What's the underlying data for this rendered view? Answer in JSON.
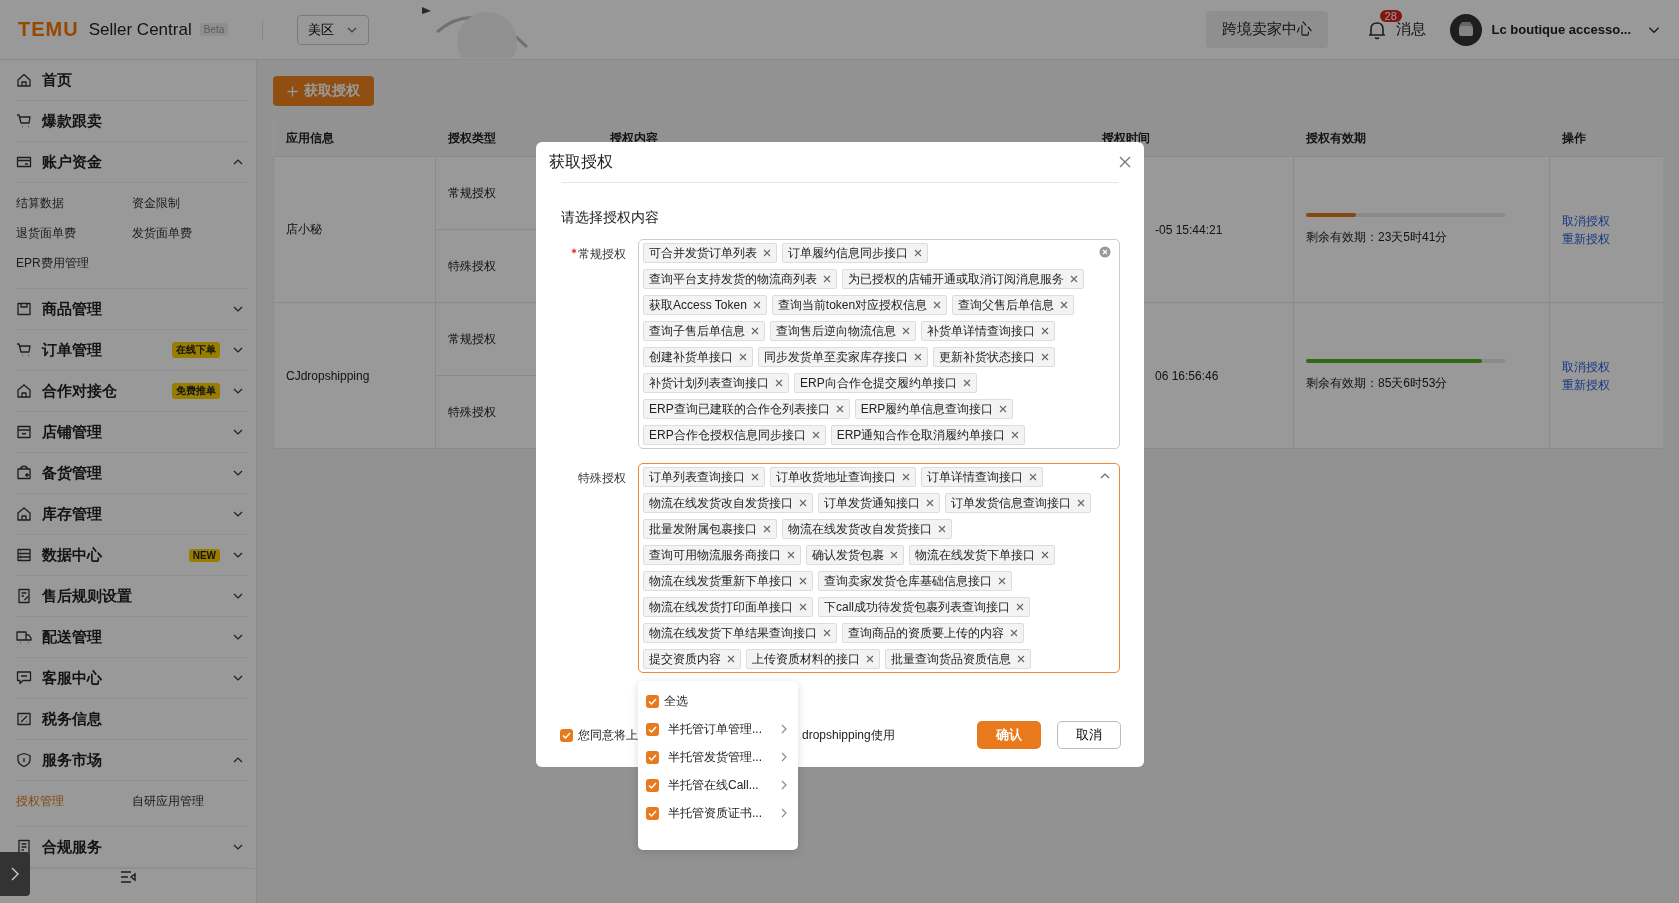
{
  "topbar": {
    "logo": "TEMU",
    "product": "Seller Central",
    "badge": "Beta",
    "region": "美区",
    "center_button": "跨境卖家中心",
    "notifications": {
      "label": "消息",
      "count": "28"
    },
    "account": "Lc boutique accesso..."
  },
  "sidebar": {
    "items": [
      {
        "label": "首页",
        "expandable": false
      },
      {
        "label": "爆款跟卖",
        "expandable": false
      },
      {
        "label": "账户资金",
        "expandable": true,
        "expanded": true,
        "children": [
          {
            "label": "结算数据",
            "selected": false
          },
          {
            "label": "资金限制",
            "selected": false
          },
          {
            "label": "退货面单费",
            "selected": false
          },
          {
            "label": "发货面单费",
            "selected": false
          },
          {
            "label": "EPR费用管理",
            "selected": false
          }
        ]
      },
      {
        "label": "商品管理",
        "expandable": true,
        "expanded": false
      },
      {
        "label": "订单管理",
        "expandable": true,
        "expanded": false,
        "badge": "在线下单"
      },
      {
        "label": "合作对接仓",
        "expandable": true,
        "expanded": false,
        "badge": "免费推单"
      },
      {
        "label": "店铺管理",
        "expandable": true,
        "expanded": false
      },
      {
        "label": "备货管理",
        "expandable": true,
        "expanded": false
      },
      {
        "label": "库存管理",
        "expandable": true,
        "expanded": false
      },
      {
        "label": "数据中心",
        "expandable": true,
        "expanded": false,
        "badge": "NEW"
      },
      {
        "label": "售后规则设置",
        "expandable": true,
        "expanded": false
      },
      {
        "label": "配送管理",
        "expandable": true,
        "expanded": false
      },
      {
        "label": "客服中心",
        "expandable": true,
        "expanded": false
      },
      {
        "label": "税务信息",
        "expandable": false
      },
      {
        "label": "服务市场",
        "expandable": true,
        "expanded": true,
        "children": [
          {
            "label": "授权管理",
            "selected": true
          },
          {
            "label": "自研应用管理",
            "selected": false
          }
        ]
      },
      {
        "label": "合规服务",
        "expandable": true,
        "expanded": false
      }
    ]
  },
  "main": {
    "add_button": "获取授权",
    "table": {
      "columns": [
        "应用信息",
        "授权类型",
        "授权内容",
        "授权时间",
        "授权有效期",
        "操作"
      ],
      "rows": [
        {
          "app": "店小秘",
          "types": [
            "常规授权",
            "特殊授权"
          ],
          "time": "-05 15:44:21",
          "validity": {
            "level": 0.25,
            "text": "剩余有效期：23天5时41分"
          },
          "actions": [
            "取消授权",
            "重新授权"
          ]
        },
        {
          "app": "CJdropshipping",
          "types": [
            "常规授权",
            "特殊授权"
          ],
          "time": "06 16:56:46",
          "validity": {
            "level": 0.88,
            "text": "剩余有效期：85天6时53分"
          },
          "actions": [
            "取消授权",
            "重新授权"
          ]
        }
      ]
    }
  },
  "modal": {
    "title": "获取授权",
    "section": "请选择授权内容",
    "fields": [
      {
        "label": "常规授权",
        "required": true,
        "focused": false,
        "tags": [
          "可合并发货订单列表",
          "订单履约信息同步接口",
          "查询平台支持发货的物流商列表",
          "为已授权的店铺开通或取消订阅消息服务",
          "获取Access Token",
          "查询当前token对应授权信息",
          "查询父售后单信息",
          "查询子售后单信息",
          "查询售后逆向物流信息",
          "补货单详情查询接口",
          "创建补货单接口",
          "同步发货单至卖家库存接口",
          "更新补货状态接口",
          "补货计划列表查询接口",
          "ERP向合作仓提交履约单接口",
          "ERP查询已建联的合作仓列表接口",
          "ERP履约单信息查询接口",
          "ERP合作仓授权信息同步接口",
          "ERP通知合作仓取消履约单接口"
        ]
      },
      {
        "label": "特殊授权",
        "required": false,
        "focused": true,
        "tags": [
          "订单列表查询接口",
          "订单收货地址查询接口",
          "订单详情查询接口",
          "物流在线发货改自发货接口",
          "订单发货通知接口",
          "订单发货信息查询接口",
          "批量发附属包裹接口",
          "物流在线发货改自发货接口",
          "查询可用物流服务商接口",
          "确认发货包裹",
          "物流在线发货下单接口",
          "物流在线发货重新下单接口",
          "查询卖家发货仓库基础信息接口",
          "物流在线发货打印面单接口",
          "下call成功待发货包裹列表查询接口",
          "物流在线发货下单结果查询接口",
          "查询商品的资质要上传的内容",
          "提交资质内容",
          "上传资质材料的接口",
          "批量查询货品资质信息"
        ]
      }
    ],
    "agreement": {
      "checked": true,
      "text_before": "您同意将上",
      "text_after": "dropshipping使用"
    },
    "buttons": [
      {
        "label": "确认",
        "kind": "primary"
      },
      {
        "label": "取消",
        "kind": "default"
      }
    ]
  },
  "dropdown": {
    "options": [
      {
        "label": "全选",
        "checked": true,
        "expandable": false
      },
      {
        "label": "半托管订单管理...",
        "checked": true,
        "expandable": true
      },
      {
        "label": "半托管发货管理...",
        "checked": true,
        "expandable": true
      },
      {
        "label": "半托管在线Call...",
        "checked": true,
        "expandable": true
      },
      {
        "label": "半托管资质证书...",
        "checked": true,
        "expandable": true
      }
    ]
  }
}
